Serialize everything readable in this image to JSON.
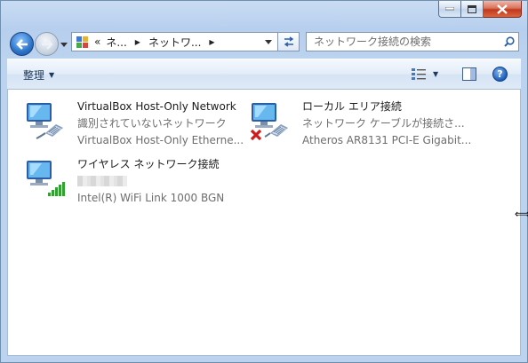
{
  "window": {
    "caption_buttons": {
      "minimize": "minimize",
      "maximize": "maximize",
      "close": "close"
    }
  },
  "navigation": {
    "breadcrumb_overflow": "«",
    "breadcrumbs": [
      "ネ...",
      "ネットワ..."
    ],
    "search_placeholder": "ネットワーク接続の検索"
  },
  "command_bar": {
    "organize_label": "整理"
  },
  "connections": [
    {
      "name": "VirtualBox Host-Only Network",
      "status": "識別されていないネットワーク",
      "device": "VirtualBox Host-Only Etherne...",
      "icon": "wired-network-icon",
      "disconnected": false
    },
    {
      "name": "ローカル エリア接続",
      "status": "ネットワーク ケーブルが接続さ...",
      "device": "Atheros AR8131 PCI-E Gigabit...",
      "icon": "wired-network-icon",
      "disconnected": true
    },
    {
      "name": "ワイヤレス ネットワーク接続",
      "status": "",
      "device": "Intel(R) WiFi Link 1000 BGN",
      "icon": "wireless-network-icon",
      "disconnected": false,
      "status_redacted": true
    }
  ],
  "colors": {
    "accent": "#2b73c8",
    "text_secondary": "#6d6d6d",
    "error_red": "#d11919",
    "signal_green": "#2fa22f"
  }
}
